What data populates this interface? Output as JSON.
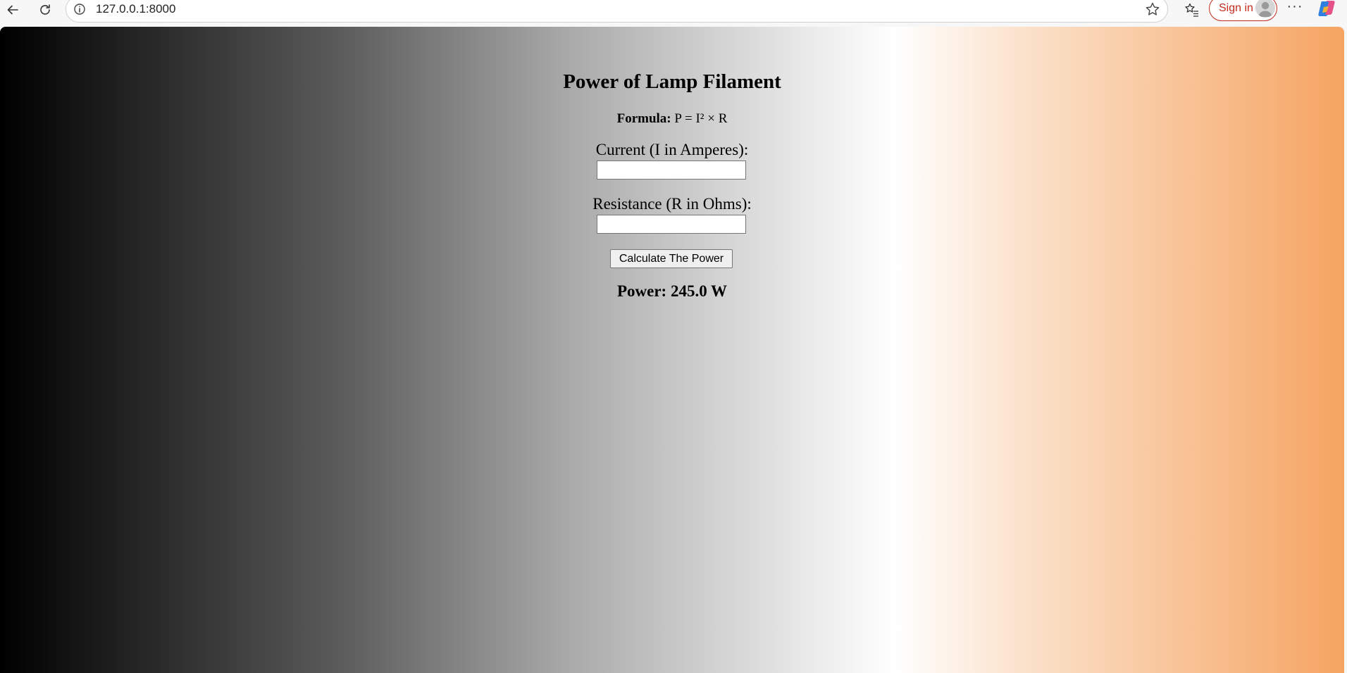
{
  "browser": {
    "url": "127.0.0.1:8000",
    "sign_in_label": "Sign in",
    "more_label": "···"
  },
  "page": {
    "title": "Power of Lamp Filament",
    "formula_label": "Formula:",
    "formula_text": "P = I² × R",
    "current_label": "Current (I in Amperes):",
    "current_value": "",
    "resistance_label": "Resistance (R in Ohms):",
    "resistance_value": "",
    "calculate_button_label": "Calculate The Power",
    "result_text": "Power: 245.0 W"
  },
  "colors": {
    "gradient": [
      "#000000",
      "#ffffff",
      "#f5a461"
    ],
    "sign_in_accent": "#c42b1c"
  }
}
